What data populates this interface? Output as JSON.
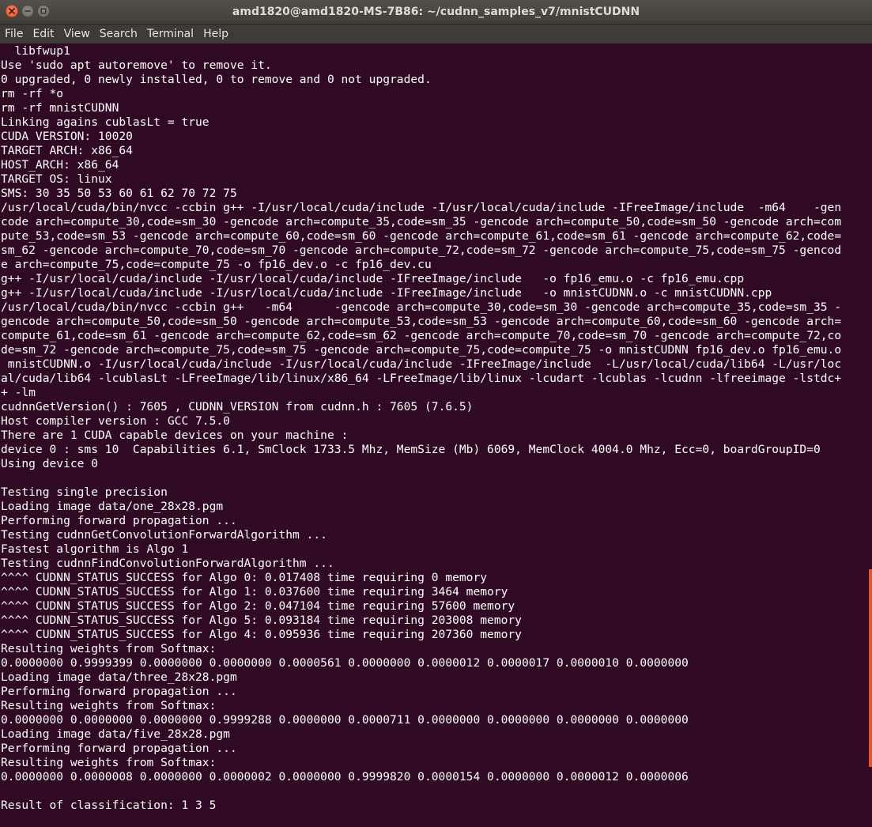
{
  "window": {
    "title": "amd1820@amd1820-MS-7B86: ~/cudnn_samples_v7/mnistCUDNN"
  },
  "menu": {
    "items": [
      "File",
      "Edit",
      "View",
      "Search",
      "Terminal",
      "Help"
    ]
  },
  "terminal": {
    "lines": [
      "  libfwup1",
      "Use 'sudo apt autoremove' to remove it.",
      "0 upgraded, 0 newly installed, 0 to remove and 0 not upgraded.",
      "rm -rf *o",
      "rm -rf mnistCUDNN",
      "Linking agains cublasLt = true",
      "CUDA VERSION: 10020",
      "TARGET ARCH: x86_64",
      "HOST_ARCH: x86_64",
      "TARGET OS: linux",
      "SMS: 30 35 50 53 60 61 62 70 72 75",
      "/usr/local/cuda/bin/nvcc -ccbin g++ -I/usr/local/cuda/include -I/usr/local/cuda/include -IFreeImage/include  -m64    -gen",
      "code arch=compute_30,code=sm_30 -gencode arch=compute_35,code=sm_35 -gencode arch=compute_50,code=sm_50 -gencode arch=com",
      "pute_53,code=sm_53 -gencode arch=compute_60,code=sm_60 -gencode arch=compute_61,code=sm_61 -gencode arch=compute_62,code=",
      "sm_62 -gencode arch=compute_70,code=sm_70 -gencode arch=compute_72,code=sm_72 -gencode arch=compute_75,code=sm_75 -gencod",
      "e arch=compute_75,code=compute_75 -o fp16_dev.o -c fp16_dev.cu",
      "g++ -I/usr/local/cuda/include -I/usr/local/cuda/include -IFreeImage/include   -o fp16_emu.o -c fp16_emu.cpp",
      "g++ -I/usr/local/cuda/include -I/usr/local/cuda/include -IFreeImage/include   -o mnistCUDNN.o -c mnistCUDNN.cpp",
      "/usr/local/cuda/bin/nvcc -ccbin g++   -m64      -gencode arch=compute_30,code=sm_30 -gencode arch=compute_35,code=sm_35 -",
      "gencode arch=compute_50,code=sm_50 -gencode arch=compute_53,code=sm_53 -gencode arch=compute_60,code=sm_60 -gencode arch=",
      "compute_61,code=sm_61 -gencode arch=compute_62,code=sm_62 -gencode arch=compute_70,code=sm_70 -gencode arch=compute_72,co",
      "de=sm_72 -gencode arch=compute_75,code=sm_75 -gencode arch=compute_75,code=compute_75 -o mnistCUDNN fp16_dev.o fp16_emu.o",
      " mnistCUDNN.o -I/usr/local/cuda/include -I/usr/local/cuda/include -IFreeImage/include  -L/usr/local/cuda/lib64 -L/usr/loc",
      "al/cuda/lib64 -lcublasLt -LFreeImage/lib/linux/x86_64 -LFreeImage/lib/linux -lcudart -lcublas -lcudnn -lfreeimage -lstdc+",
      "+ -lm",
      "cudnnGetVersion() : 7605 , CUDNN_VERSION from cudnn.h : 7605 (7.6.5)",
      "Host compiler version : GCC 7.5.0",
      "There are 1 CUDA capable devices on your machine :",
      "device 0 : sms 10  Capabilities 6.1, SmClock 1733.5 Mhz, MemSize (Mb) 6069, MemClock 4004.0 Mhz, Ecc=0, boardGroupID=0",
      "Using device 0",
      "",
      "Testing single precision",
      "Loading image data/one_28x28.pgm",
      "Performing forward propagation ...",
      "Testing cudnnGetConvolutionForwardAlgorithm ...",
      "Fastest algorithm is Algo 1",
      "Testing cudnnFindConvolutionForwardAlgorithm ...",
      "^^^^ CUDNN_STATUS_SUCCESS for Algo 0: 0.017408 time requiring 0 memory",
      "^^^^ CUDNN_STATUS_SUCCESS for Algo 1: 0.037600 time requiring 3464 memory",
      "^^^^ CUDNN_STATUS_SUCCESS for Algo 2: 0.047104 time requiring 57600 memory",
      "^^^^ CUDNN_STATUS_SUCCESS for Algo 5: 0.093184 time requiring 203008 memory",
      "^^^^ CUDNN_STATUS_SUCCESS for Algo 4: 0.095936 time requiring 207360 memory",
      "Resulting weights from Softmax:",
      "0.0000000 0.9999399 0.0000000 0.0000000 0.0000561 0.0000000 0.0000012 0.0000017 0.0000010 0.0000000",
      "Loading image data/three_28x28.pgm",
      "Performing forward propagation ...",
      "Resulting weights from Softmax:",
      "0.0000000 0.0000000 0.0000000 0.9999288 0.0000000 0.0000711 0.0000000 0.0000000 0.0000000 0.0000000",
      "Loading image data/five_28x28.pgm",
      "Performing forward propagation ...",
      "Resulting weights from Softmax:",
      "0.0000000 0.0000008 0.0000000 0.0000002 0.0000000 0.9999820 0.0000154 0.0000000 0.0000012 0.0000006",
      "",
      "Result of classification: 1 3 5"
    ]
  },
  "colors": {
    "terminal_bg": "#300a24",
    "text": "#ffffff",
    "scrollbar": "#e95420"
  },
  "icons": [
    "close-icon",
    "minimize-icon",
    "maximize-icon"
  ]
}
